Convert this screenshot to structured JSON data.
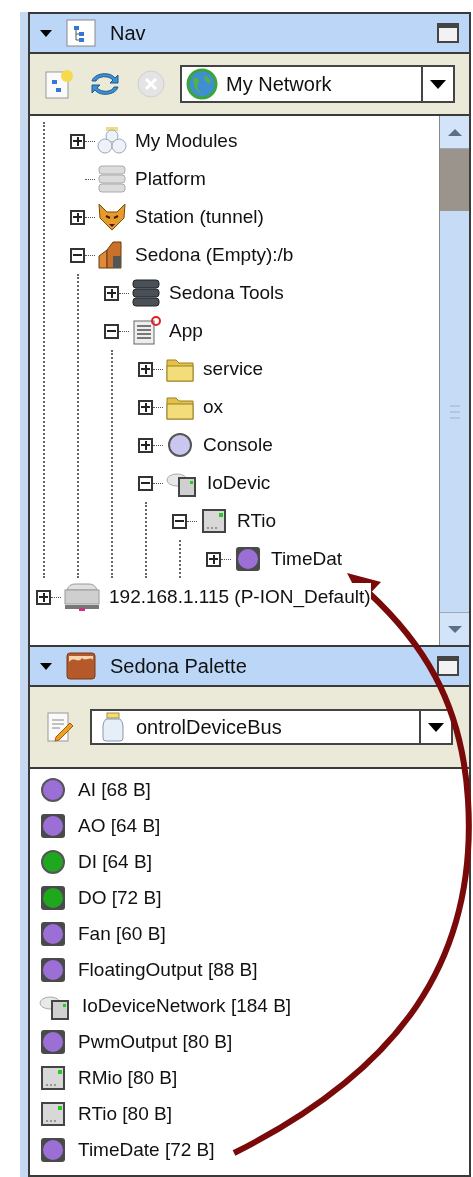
{
  "nav_panel": {
    "title": "Nav",
    "network_dropdown": {
      "value": "My Network"
    },
    "tree": [
      {
        "expanded": true,
        "children": [
          {
            "label": "My Modules",
            "kind": "modules",
            "expanded": false
          },
          {
            "label": "Platform",
            "kind": "platform"
          },
          {
            "label": "Station (tunnel)",
            "kind": "fox",
            "expanded": false
          },
          {
            "label": "Sedona (Empty):/b",
            "kind": "sedona",
            "expanded": true,
            "children": [
              {
                "label": "Sedona Tools",
                "kind": "tools",
                "expanded": false
              },
              {
                "label": "App",
                "kind": "app",
                "expanded": true,
                "children": [
                  {
                    "label": "service",
                    "kind": "folder",
                    "expanded": false
                  },
                  {
                    "label": "ox",
                    "kind": "folder",
                    "expanded": false
                  },
                  {
                    "label": "Console",
                    "kind": "console",
                    "expanded": false
                  },
                  {
                    "label": "IoDevic",
                    "kind": "network",
                    "expanded": true,
                    "children": [
                      {
                        "label": "RTio",
                        "kind": "device",
                        "expanded": true,
                        "children": [
                          {
                            "label": "TimeDat",
                            "kind": "square",
                            "color": "#9b6fd6",
                            "expanded": false
                          }
                        ]
                      }
                    ]
                  }
                ]
              }
            ]
          }
        ]
      },
      {
        "label": "192.168.1.115 (P-ION_Default)",
        "kind": "host",
        "expanded": false
      }
    ]
  },
  "palette_panel": {
    "title": "Sedona Palette",
    "kit_dropdown": {
      "value": "ontrolDeviceBus"
    },
    "items": [
      {
        "label": "AI [68 B]",
        "kind": "circle",
        "color": "#9b6fd6"
      },
      {
        "label": "AO [64 B]",
        "kind": "square",
        "color": "#9b6fd6"
      },
      {
        "label": "DI [64 B]",
        "kind": "circle",
        "color": "#1fa81f"
      },
      {
        "label": "DO [72 B]",
        "kind": "square",
        "color": "#1fa81f"
      },
      {
        "label": "Fan [60 B]",
        "kind": "square",
        "color": "#9b6fd6"
      },
      {
        "label": "FloatingOutput [88 B]",
        "kind": "square",
        "color": "#9b6fd6"
      },
      {
        "label": "IoDeviceNetwork [184 B]",
        "kind": "network"
      },
      {
        "label": "PwmOutput [80 B]",
        "kind": "square",
        "color": "#9b6fd6"
      },
      {
        "label": "RMio [80 B]",
        "kind": "device"
      },
      {
        "label": "RTio [80 B]",
        "kind": "device"
      },
      {
        "label": "TimeDate [72 B]",
        "kind": "square",
        "color": "#9b6fd6"
      }
    ]
  }
}
